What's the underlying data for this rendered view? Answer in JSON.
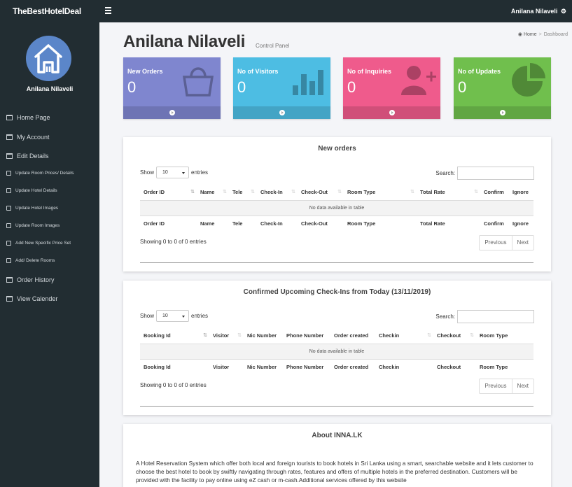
{
  "topbar": {
    "brand": "TheBestHotelDeal",
    "user": "Anilana Nilaveli"
  },
  "sidebar": {
    "name": "Anilana Nilaveli",
    "items": [
      {
        "label": "Home Page",
        "icon": "calendar-icon",
        "size": "big"
      },
      {
        "label": "My Account",
        "icon": "calendar-icon",
        "size": "big"
      },
      {
        "label": "Edit Details",
        "icon": "calendar-icon",
        "size": "big"
      },
      {
        "label": "Update Room Prices/ Details",
        "icon": "edit-icon",
        "size": "small"
      },
      {
        "label": "Update Hotel Details",
        "icon": "edit-icon",
        "size": "small"
      },
      {
        "label": "Update Hotel Images",
        "icon": "edit-icon",
        "size": "small"
      },
      {
        "label": "Update Room Images",
        "icon": "edit-icon",
        "size": "small"
      },
      {
        "label": "Add New Specific Price Set",
        "icon": "edit-icon",
        "size": "small"
      },
      {
        "label": "Add/ Delete Rooms",
        "icon": "edit-icon",
        "size": "small"
      },
      {
        "label": "Order History",
        "icon": "calendar-icon",
        "size": "big"
      },
      {
        "label": "View Calender",
        "icon": "calendar-icon",
        "size": "big"
      }
    ]
  },
  "header": {
    "title": "Anilana Nilaveli",
    "subtitle": "Control Panel",
    "breadcrumb": {
      "home": "Home",
      "current": "Dashboard"
    }
  },
  "stats": [
    {
      "label": "New Orders",
      "value": "0",
      "color": "#7f86cf",
      "icon": "shopping-bag-icon"
    },
    {
      "label": "No of Visitors",
      "value": "0",
      "color": "#4dbde3",
      "icon": "bar-chart-icon"
    },
    {
      "label": "No of Inquiries",
      "value": "0",
      "color": "#ef5b8c",
      "icon": "add-user-icon"
    },
    {
      "label": "No of Updates",
      "value": "0",
      "color": "#70bf4d",
      "icon": "pie-chart-icon"
    }
  ],
  "orders": {
    "title": "New orders",
    "show": "Show",
    "entries_value": "10",
    "entries": "entries",
    "search": "Search:",
    "columns": [
      "Order ID",
      "Name",
      "Tele",
      "Check-In",
      "Check-Out",
      "Room Type",
      "Total Rate",
      "Confirm",
      "Ignore"
    ],
    "empty": "No data available in table",
    "info": "Showing 0 to 0 of 0 entries",
    "prev": "Previous",
    "next": "Next"
  },
  "checkins": {
    "title": "Confirmed Upcoming Check-Ins from Today (13/11/2019)",
    "show": "Show",
    "entries_value": "10",
    "entries": "entries",
    "search": "Search:",
    "columns": [
      "Booking Id",
      "Visitor",
      "Nic Number",
      "Phone Number",
      "Order created",
      "Checkin",
      "Checkout",
      "Room Type"
    ],
    "empty": "No data available in table",
    "info": "Showing 0 to 0 of 0 entries",
    "prev": "Previous",
    "next": "Next"
  },
  "about": {
    "title": "About INNA.LK",
    "text": "A Hotel Reservation System which offer both local and foreign tourists to book hotels in Sri Lanka using a smart, searchable website and it lets customer to choose the best hotel to book by swiftly navigating through rates, features and offers of multiple hotels in the preferred destination. Customers will be provided with the facility to pay online using eZ cash or m-cash.Additional services offered by this website"
  }
}
